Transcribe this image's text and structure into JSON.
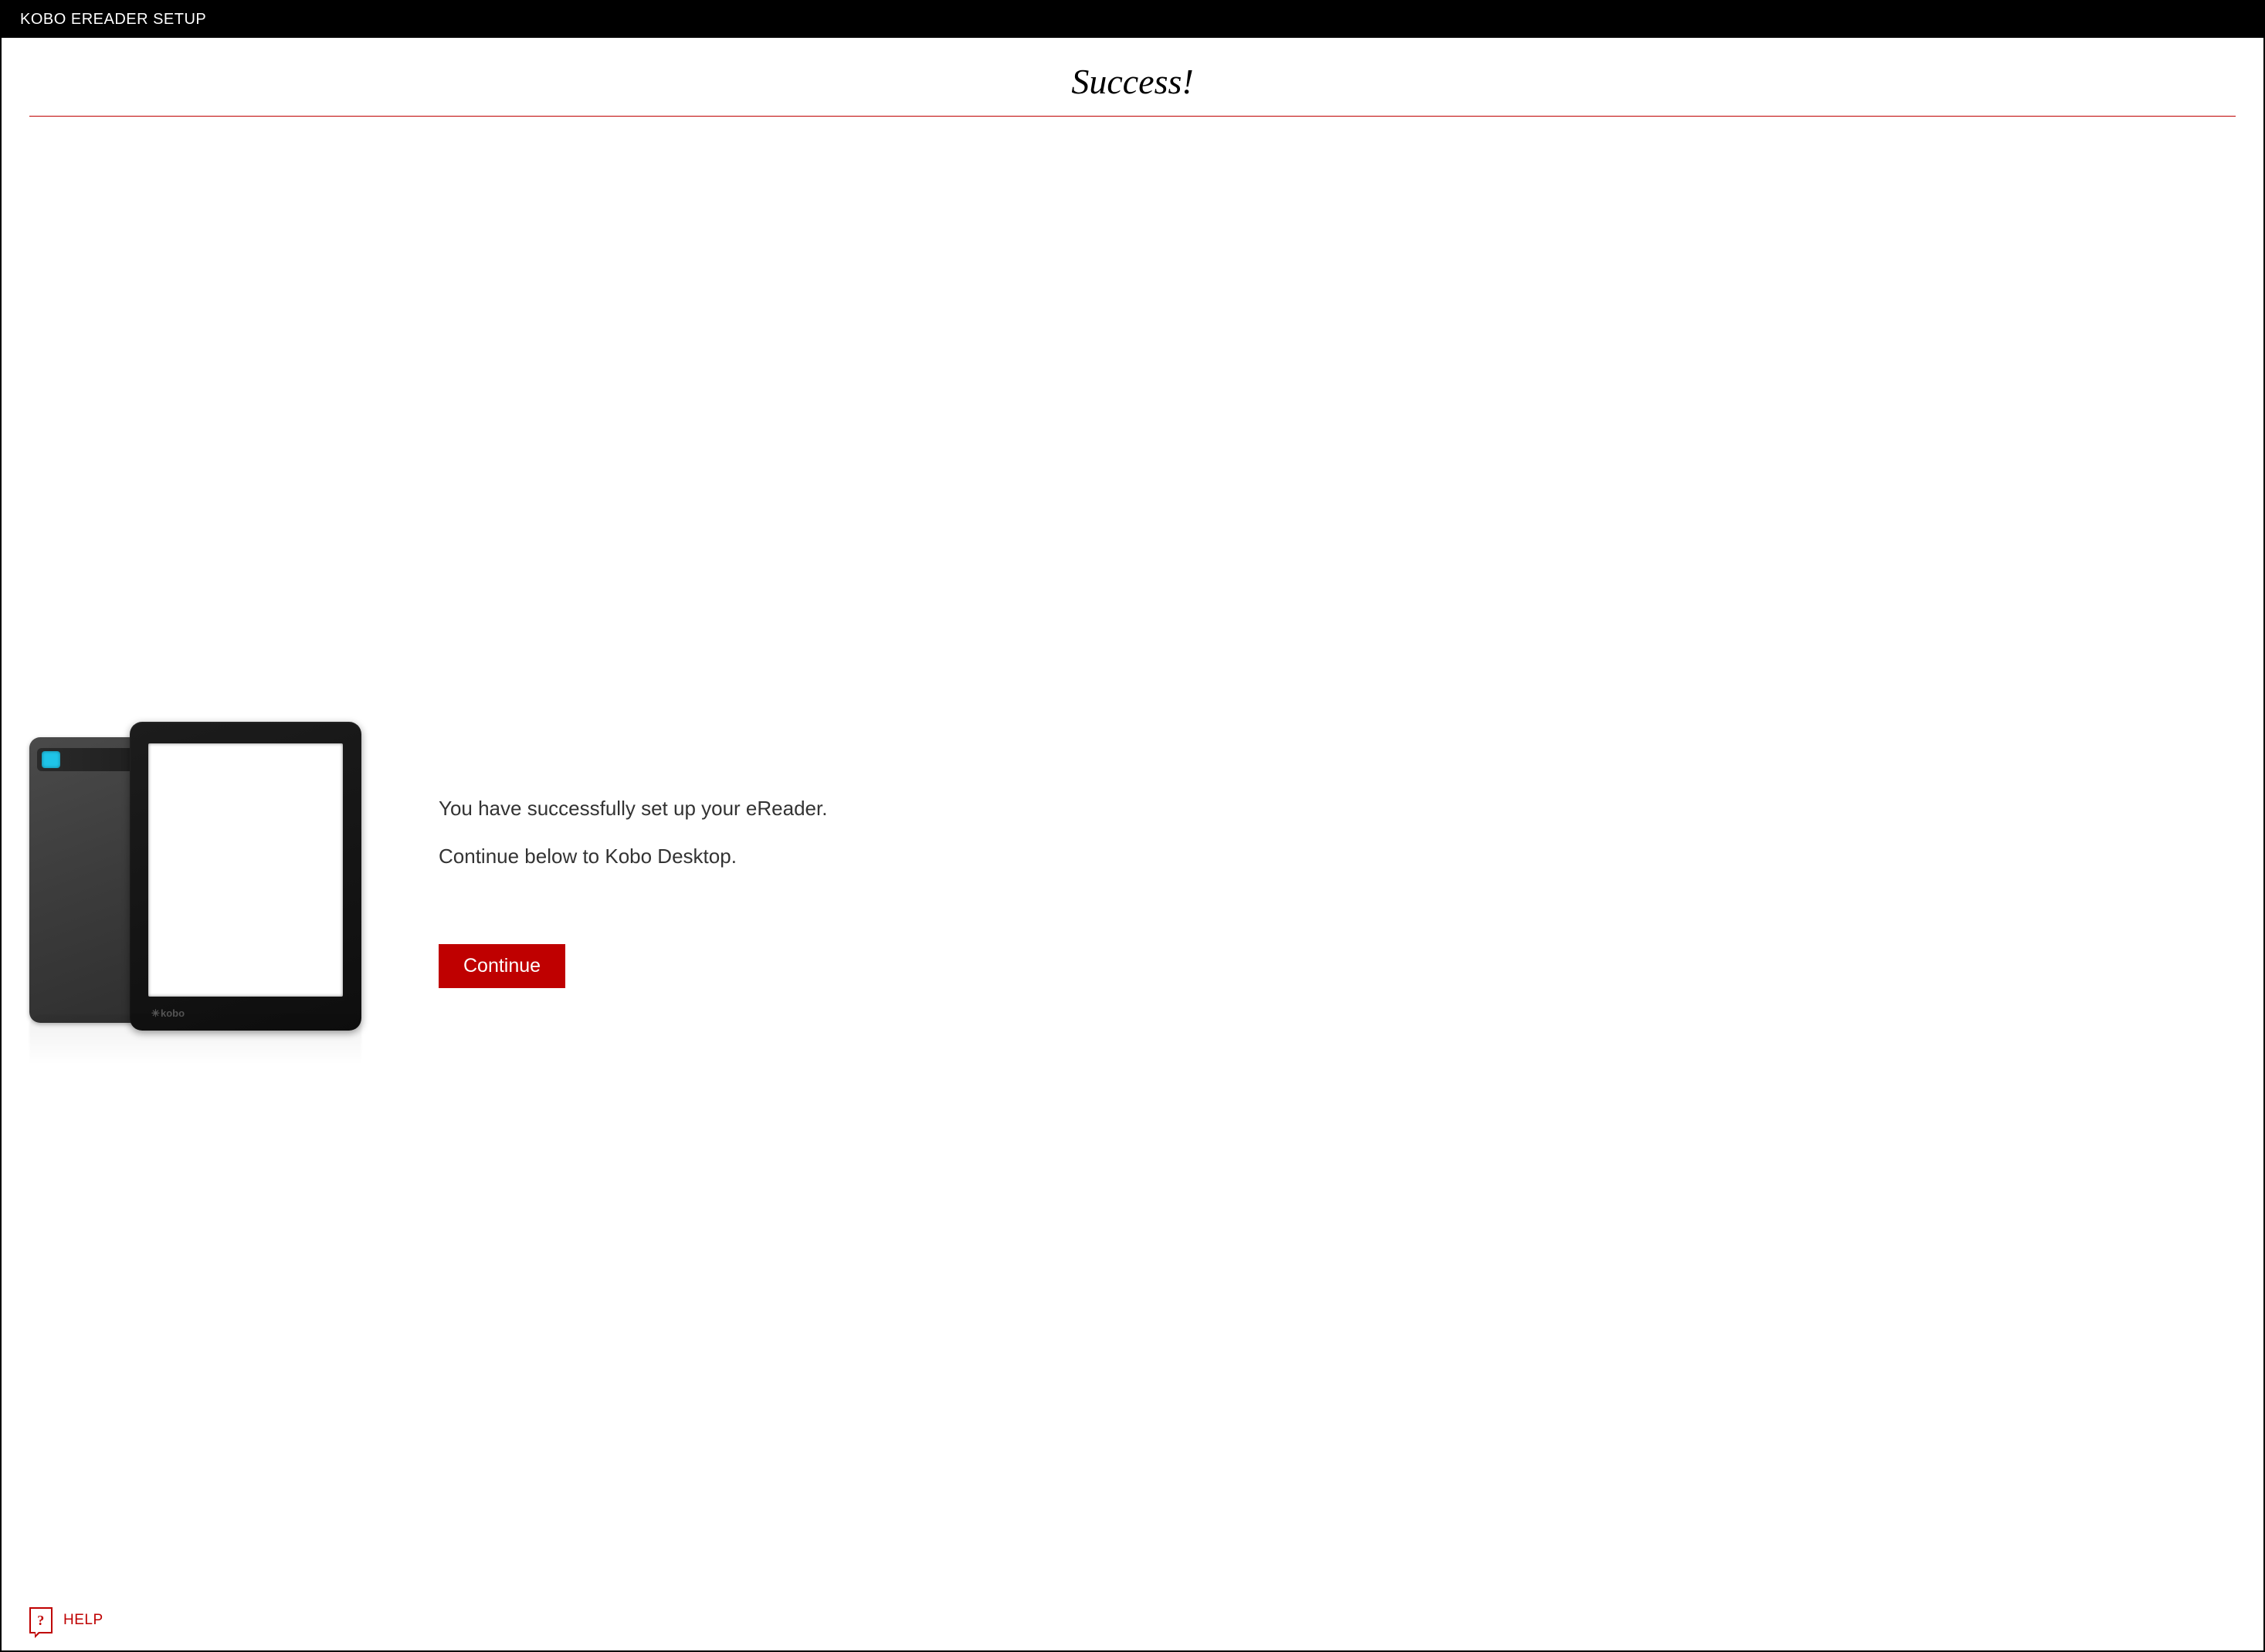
{
  "title_bar": "KOBO EREADER SETUP",
  "heading": "Success!",
  "device_brand": "kobo",
  "message": {
    "line1": "You have successfully set up your eReader.",
    "line2": "Continue below to Kobo Desktop."
  },
  "continue_label": "Continue",
  "help_label": "HELP",
  "colors": {
    "accent": "#bf0000",
    "header_bg": "#000000"
  }
}
